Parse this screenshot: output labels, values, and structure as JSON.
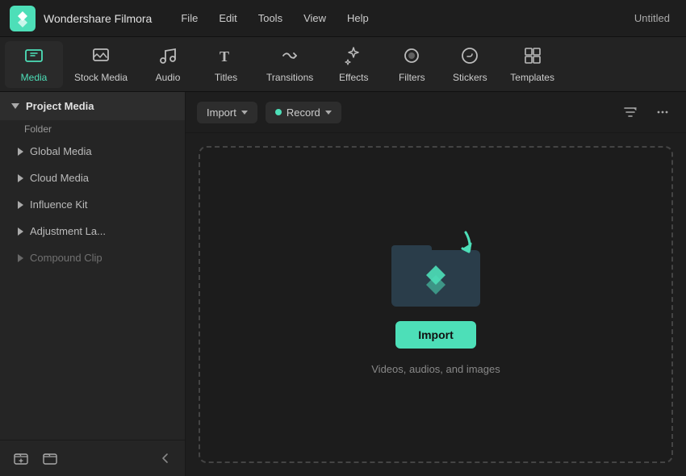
{
  "titleBar": {
    "appName": "Wondershare Filmora",
    "menu": [
      "File",
      "Edit",
      "Tools",
      "View",
      "Help"
    ],
    "windowTitle": "Untitled"
  },
  "tabs": [
    {
      "id": "media",
      "label": "Media",
      "icon": "🎬",
      "active": true
    },
    {
      "id": "stock-media",
      "label": "Stock Media",
      "icon": "🖼"
    },
    {
      "id": "audio",
      "label": "Audio",
      "icon": "🎵"
    },
    {
      "id": "titles",
      "label": "Titles",
      "icon": "T"
    },
    {
      "id": "transitions",
      "label": "Transitions",
      "icon": "↩"
    },
    {
      "id": "effects",
      "label": "Effects",
      "icon": "✦"
    },
    {
      "id": "filters",
      "label": "Filters",
      "icon": "🔵"
    },
    {
      "id": "stickers",
      "label": "Stickers",
      "icon": "✂"
    },
    {
      "id": "templates",
      "label": "Templates",
      "icon": "⊞"
    }
  ],
  "sidebar": {
    "projectMediaLabel": "Project Media",
    "folderLabel": "Folder",
    "items": [
      {
        "label": "Global Media"
      },
      {
        "label": "Cloud Media"
      },
      {
        "label": "Influence Kit"
      },
      {
        "label": "Adjustment La..."
      },
      {
        "label": "Compound Clip"
      }
    ],
    "footer": {
      "addFolderIcon": "+📁",
      "importFolderIcon": "📂",
      "collapseIcon": "❮"
    }
  },
  "toolbar": {
    "importLabel": "Import",
    "recordLabel": "Record",
    "filterIconLabel": "filter-sort-icon",
    "moreIconLabel": "more-options-icon"
  },
  "dropZone": {
    "importButtonLabel": "Import",
    "hintText": "Videos, audios, and images"
  }
}
